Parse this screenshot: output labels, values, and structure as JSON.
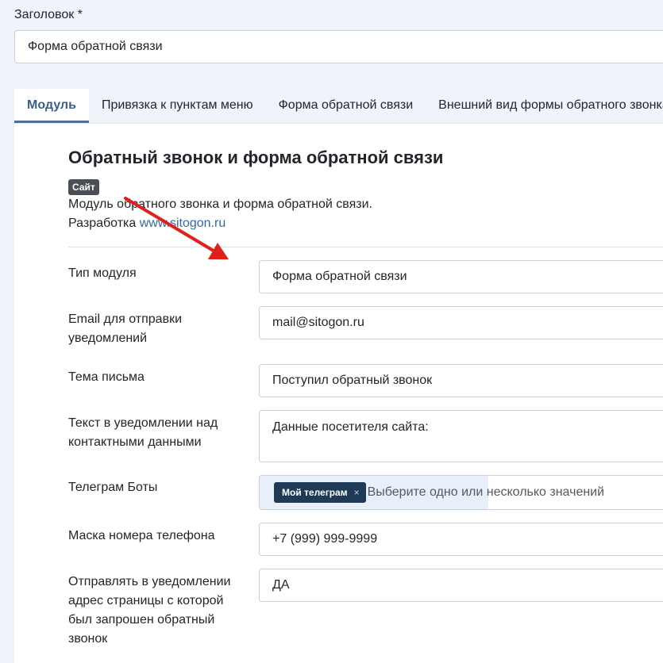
{
  "title_field": {
    "label": "Заголовок *",
    "value": "Форма обратной связи"
  },
  "tabs": [
    {
      "label": "Модуль",
      "active": true
    },
    {
      "label": "Привязка к пунктам меню"
    },
    {
      "label": "Форма обратной связи"
    },
    {
      "label": "Внешний вид формы обратного звонка"
    }
  ],
  "module": {
    "title": "Обратный звонок и форма обратной связи",
    "badge": "Сайт",
    "description": "Модуль обратного звонка и форма обратной связи.",
    "dev_prefix": "Разработка ",
    "dev_link": "www.sitogon.ru"
  },
  "fields": {
    "module_type": {
      "label": "Тип модуля",
      "value": "Форма обратной связи"
    },
    "email": {
      "label": "Email для отправки уведомлений",
      "value": "mail@sitogon.ru"
    },
    "subject": {
      "label": "Тема письма",
      "value": "Поступил обратный звонок"
    },
    "notify_text": {
      "label": "Текст в уведомлении над контактными данными",
      "value": "Данные посетителя сайта:"
    },
    "telegram": {
      "label": "Телеграм Боты",
      "chip": "Мой телеграм",
      "chip_remove": "×",
      "placeholder": "Выберите одно или несколько значений"
    },
    "phone_mask": {
      "label": "Маска номера телефона",
      "value": "+7 (999) 999-9999"
    },
    "send_url": {
      "label": "Отправлять в уведомлении адрес страницы с которой был запрошен обратный звонок",
      "value": "ДА"
    }
  },
  "colors": {
    "accent": "#4d6e98",
    "chip_bg": "#1f3a56",
    "arrow": "#e0201b"
  }
}
